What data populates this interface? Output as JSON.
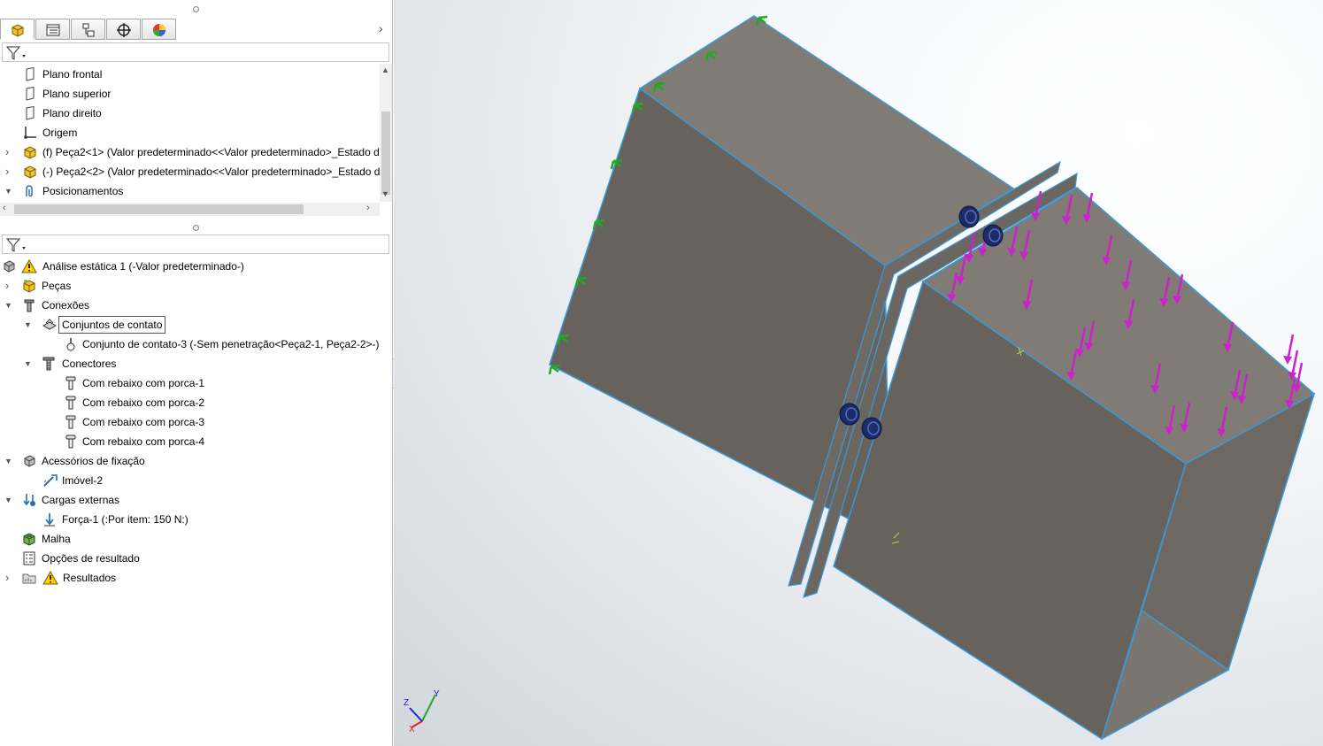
{
  "feature_tabs": [
    {
      "icon": "part-icon",
      "active": true
    },
    {
      "icon": "property-manager-icon",
      "active": false
    },
    {
      "icon": "configuration-manager-icon",
      "active": false
    },
    {
      "icon": "dimxpert-icon",
      "active": false
    },
    {
      "icon": "appearance-icon",
      "active": false
    }
  ],
  "feature_tree": {
    "items": [
      {
        "label": "Plano frontal",
        "icon": "plane-icon"
      },
      {
        "label": "Plano superior",
        "icon": "plane-icon"
      },
      {
        "label": "Plano direito",
        "icon": "plane-icon"
      },
      {
        "label": "Origem",
        "icon": "origin-icon"
      },
      {
        "label": "(f) Peça2<1> (Valor predeterminado<<Valor predeterminado>_Estado d",
        "icon": "component-icon"
      },
      {
        "label": "(-) Peça2<2> (Valor predeterminado<<Valor predeterminado>_Estado d",
        "icon": "component-icon"
      },
      {
        "label": "Posicionamentos",
        "icon": "mates-icon"
      }
    ]
  },
  "study_tree": {
    "items": [
      {
        "label": "Análise estática 1 (-Valor predeterminado-)",
        "icon": "warning-icon"
      },
      {
        "label": "Peças",
        "icon": "parts-icon"
      },
      {
        "label": "Conexões",
        "icon": "connections-icon"
      },
      {
        "label": "Conjuntos de contato",
        "icon": "contact-sets-icon"
      },
      {
        "label": "Conjunto de contato-3 (-Sem penetração<Peça2-1, Peça2-2>-)",
        "icon": "contact-set-icon"
      },
      {
        "label": "Conectores",
        "icon": "connectors-icon"
      },
      {
        "label": "Com rebaixo com porca-1",
        "icon": "bolt-icon"
      },
      {
        "label": "Com rebaixo com porca-2",
        "icon": "bolt-icon"
      },
      {
        "label": "Com rebaixo com porca-3",
        "icon": "bolt-icon"
      },
      {
        "label": "Com rebaixo com porca-4",
        "icon": "bolt-icon"
      },
      {
        "label": "Acessórios de fixação",
        "icon": "fixtures-icon"
      },
      {
        "label": "Imóvel-2",
        "icon": "fixed-geometry-icon"
      },
      {
        "label": "Cargas externas",
        "icon": "external-loads-icon"
      },
      {
        "label": "Força-1 (:Por item: 150 N:)",
        "icon": "force-icon"
      },
      {
        "label": "Malha",
        "icon": "mesh-icon"
      },
      {
        "label": "Opções de resultado",
        "icon": "result-options-icon"
      },
      {
        "label": "Resultados",
        "icon": "results-icon"
      }
    ]
  },
  "triad": {
    "x": "X",
    "y": "Y",
    "z": "Z"
  },
  "colors": {
    "face_top": "#7f7a73",
    "face_side": "#68635d",
    "edge": "#3a9ad9",
    "fixture": "#22aa22",
    "force": "#cc22cc",
    "bolt": "#1b2c6b"
  }
}
